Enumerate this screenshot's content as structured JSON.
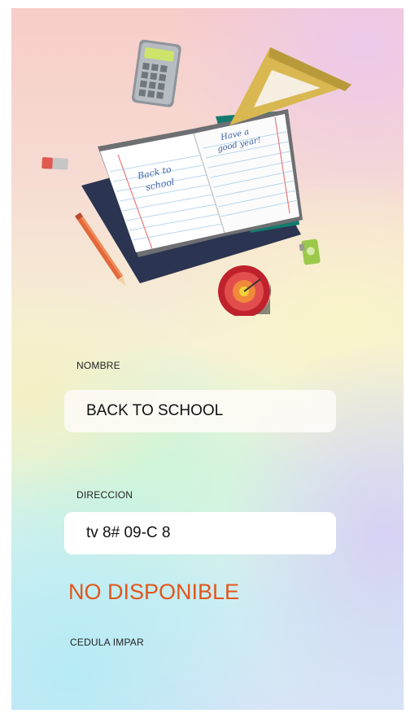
{
  "form": {
    "nombre_label": "NOMBRE",
    "nombre_value": "BACK TO SCHOOL",
    "direccion_label": "DIRECCION",
    "direccion_value": "tv 8# 09-C 8",
    "status": "NO DISPONIBLE",
    "cedula_label": "CEDULA IMPAR"
  },
  "illustration": {
    "left_page_text_1": "Back to",
    "left_page_text_2": "school",
    "right_page_text_1": "Have a",
    "right_page_text_2": "good year!"
  },
  "colors": {
    "status": "#e2561b",
    "input_background": "#ffffff"
  }
}
